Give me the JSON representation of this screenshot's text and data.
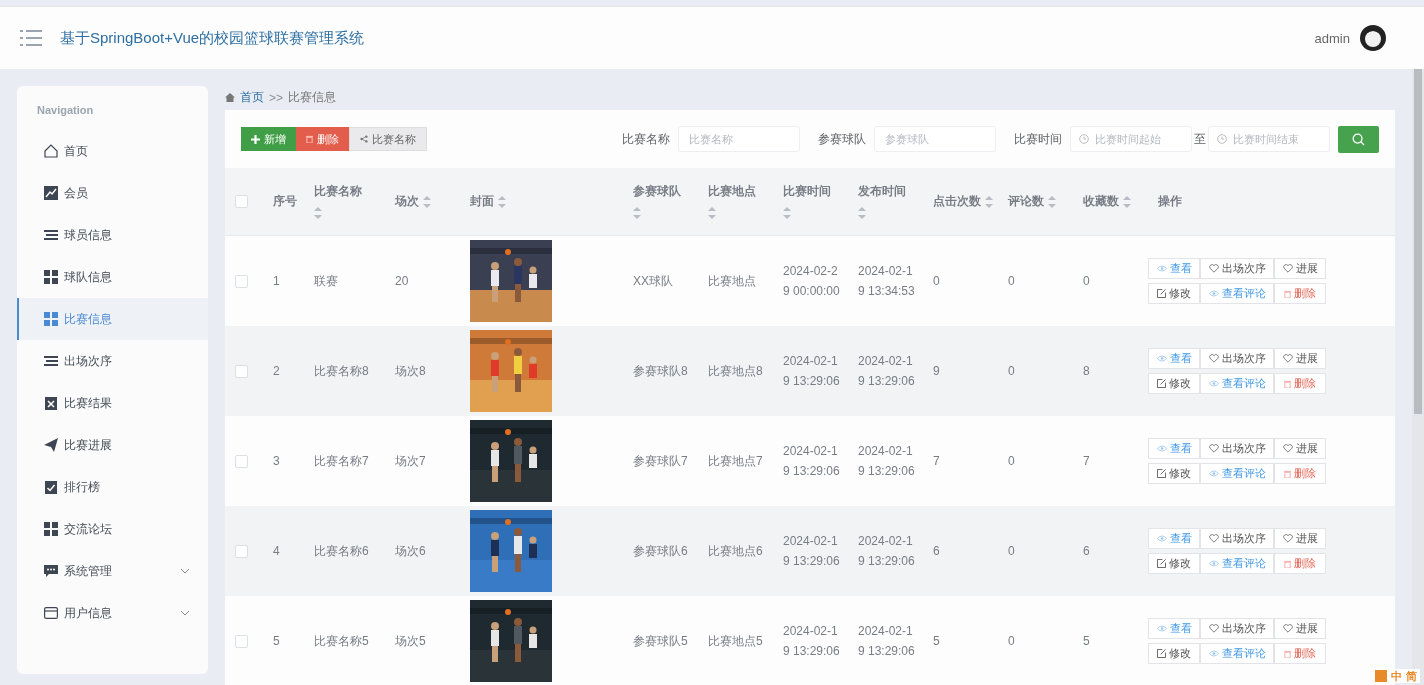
{
  "header": {
    "title": "基于SpringBoot+Vue的校园篮球联赛管理系统",
    "user": "admin"
  },
  "sidebar": {
    "heading": "Navigation",
    "items": [
      {
        "label": "首页",
        "kind": "link",
        "selected": false
      },
      {
        "label": "会员",
        "kind": "link",
        "selected": false
      },
      {
        "label": "球员信息",
        "kind": "link",
        "selected": false
      },
      {
        "label": "球队信息",
        "kind": "link",
        "selected": false
      },
      {
        "label": "比赛信息",
        "kind": "link",
        "selected": true
      },
      {
        "label": "出场次序",
        "kind": "link",
        "selected": false
      },
      {
        "label": "比赛结果",
        "kind": "link",
        "selected": false
      },
      {
        "label": "比赛进展",
        "kind": "link",
        "selected": false
      },
      {
        "label": "排行榜",
        "kind": "link",
        "selected": false
      },
      {
        "label": "交流论坛",
        "kind": "link",
        "selected": false
      },
      {
        "label": "系统管理",
        "kind": "group",
        "selected": false
      },
      {
        "label": "用户信息",
        "kind": "group",
        "selected": false
      }
    ]
  },
  "breadcrumb": {
    "home": "首页",
    "separator": ">>",
    "current": "比赛信息"
  },
  "toolbar": {
    "add": "新增",
    "delete": "删除",
    "share": "比赛名称"
  },
  "filters": [
    {
      "kind": "text",
      "label": "比赛名称",
      "placeholder": "比赛名称"
    },
    {
      "kind": "text",
      "label": "参赛球队",
      "placeholder": "参赛球队"
    },
    {
      "kind": "range",
      "label": "比赛时间",
      "placeholder": "比赛时间起始",
      "separator": "至",
      "placeholder_end": "比赛时间结束"
    }
  ],
  "table": {
    "all_checked": false,
    "columns": [
      {
        "label": "序号",
        "sortable": false
      },
      {
        "label": "比赛名称",
        "sortable": true
      },
      {
        "label": "场次",
        "sortable": true
      },
      {
        "label": "封面",
        "sortable": true
      },
      {
        "label": "参赛球队",
        "sortable": true
      },
      {
        "label": "比赛地点",
        "sortable": true
      },
      {
        "label": "比赛时间",
        "sortable": true
      },
      {
        "label": "发布时间",
        "sortable": true
      },
      {
        "label": "点击次数",
        "sortable": true
      },
      {
        "label": "评论数",
        "sortable": true
      },
      {
        "label": "收藏数",
        "sortable": true
      },
      {
        "label": "操作",
        "sortable": false
      }
    ],
    "rows": [
      {
        "checked": false,
        "cells": [
          "1",
          "联赛",
          "20",
          {
            "kind": "picture"
          },
          "XX球队",
          "比赛地点",
          "2024-02-29 00:00:00",
          "2024-02-19 13:34:53",
          "0",
          "0",
          "0"
        ],
        "actions": [
          {
            "label": "查看",
            "kind": "view"
          },
          {
            "label": "出场次序",
            "kind": "heart"
          },
          {
            "label": "进展",
            "kind": "heart"
          },
          {
            "label": "修改",
            "kind": "edit"
          },
          {
            "label": "查看评论",
            "kind": "view"
          },
          {
            "label": "删除",
            "kind": "delete"
          }
        ]
      },
      {
        "checked": false,
        "cells": [
          "2",
          "比赛名称8",
          "场次8",
          {
            "kind": "picture"
          },
          "参赛球队8",
          "比赛地点8",
          "2024-02-19 13:29:06",
          "2024-02-19 13:29:06",
          "9",
          "0",
          "8"
        ],
        "actions": [
          {
            "label": "查看",
            "kind": "view"
          },
          {
            "label": "出场次序",
            "kind": "heart"
          },
          {
            "label": "进展",
            "kind": "heart"
          },
          {
            "label": "修改",
            "kind": "edit"
          },
          {
            "label": "查看评论",
            "kind": "view"
          },
          {
            "label": "删除",
            "kind": "delete"
          }
        ]
      },
      {
        "checked": false,
        "cells": [
          "3",
          "比赛名称7",
          "场次7",
          {
            "kind": "picture"
          },
          "参赛球队7",
          "比赛地点7",
          "2024-02-19 13:29:06",
          "2024-02-19 13:29:06",
          "7",
          "0",
          "7"
        ],
        "actions": [
          {
            "label": "查看",
            "kind": "view"
          },
          {
            "label": "出场次序",
            "kind": "heart"
          },
          {
            "label": "进展",
            "kind": "heart"
          },
          {
            "label": "修改",
            "kind": "edit"
          },
          {
            "label": "查看评论",
            "kind": "view"
          },
          {
            "label": "删除",
            "kind": "delete"
          }
        ]
      },
      {
        "checked": false,
        "cells": [
          "4",
          "比赛名称6",
          "场次6",
          {
            "kind": "picture"
          },
          "参赛球队6",
          "比赛地点6",
          "2024-02-19 13:29:06",
          "2024-02-19 13:29:06",
          "6",
          "0",
          "6"
        ],
        "actions": [
          {
            "label": "查看",
            "kind": "view"
          },
          {
            "label": "出场次序",
            "kind": "heart"
          },
          {
            "label": "进展",
            "kind": "heart"
          },
          {
            "label": "修改",
            "kind": "edit"
          },
          {
            "label": "查看评论",
            "kind": "view"
          },
          {
            "label": "删除",
            "kind": "delete"
          }
        ]
      },
      {
        "checked": false,
        "cells": [
          "5",
          "比赛名称5",
          "场次5",
          {
            "kind": "picture"
          },
          "参赛球队5",
          "比赛地点5",
          "2024-02-19 13:29:06",
          "2024-02-19 13:29:06",
          "5",
          "0",
          "5"
        ],
        "actions": [
          {
            "label": "查看",
            "kind": "view"
          },
          {
            "label": "出场次序",
            "kind": "heart"
          },
          {
            "label": "进展",
            "kind": "heart"
          },
          {
            "label": "修改",
            "kind": "edit"
          },
          {
            "label": "查看评论",
            "kind": "view"
          },
          {
            "label": "删除",
            "kind": "delete"
          }
        ]
      }
    ]
  },
  "ime_bar": {
    "mode": "中",
    "script": "简"
  }
}
